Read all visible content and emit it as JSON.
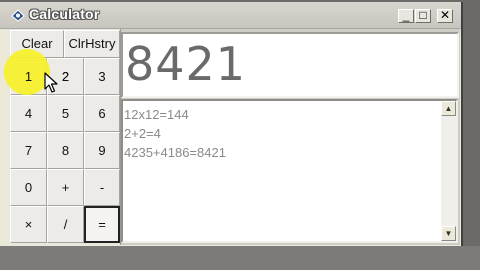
{
  "window": {
    "title": "Calculator",
    "controls": {
      "minimize": "_",
      "maximize": "□",
      "close": "✕"
    }
  },
  "display": {
    "value": "8421"
  },
  "keypad": {
    "clear": "Clear",
    "clear_history": "ClrHstry",
    "rows": [
      [
        "1",
        "2",
        "3"
      ],
      [
        "4",
        "5",
        "6"
      ],
      [
        "7",
        "8",
        "9"
      ],
      [
        "0",
        "+",
        "-"
      ],
      [
        "×",
        "/",
        "="
      ]
    ]
  },
  "history": {
    "lines": [
      "12x12=144",
      "2+2=4",
      "4235+4186=8421"
    ]
  },
  "scrollbar": {
    "up": "▲",
    "down": "▼"
  },
  "colors": {
    "highlight": "#f6f028",
    "display_text": "#6a6a6a",
    "history_text": "#8a8a8a"
  }
}
